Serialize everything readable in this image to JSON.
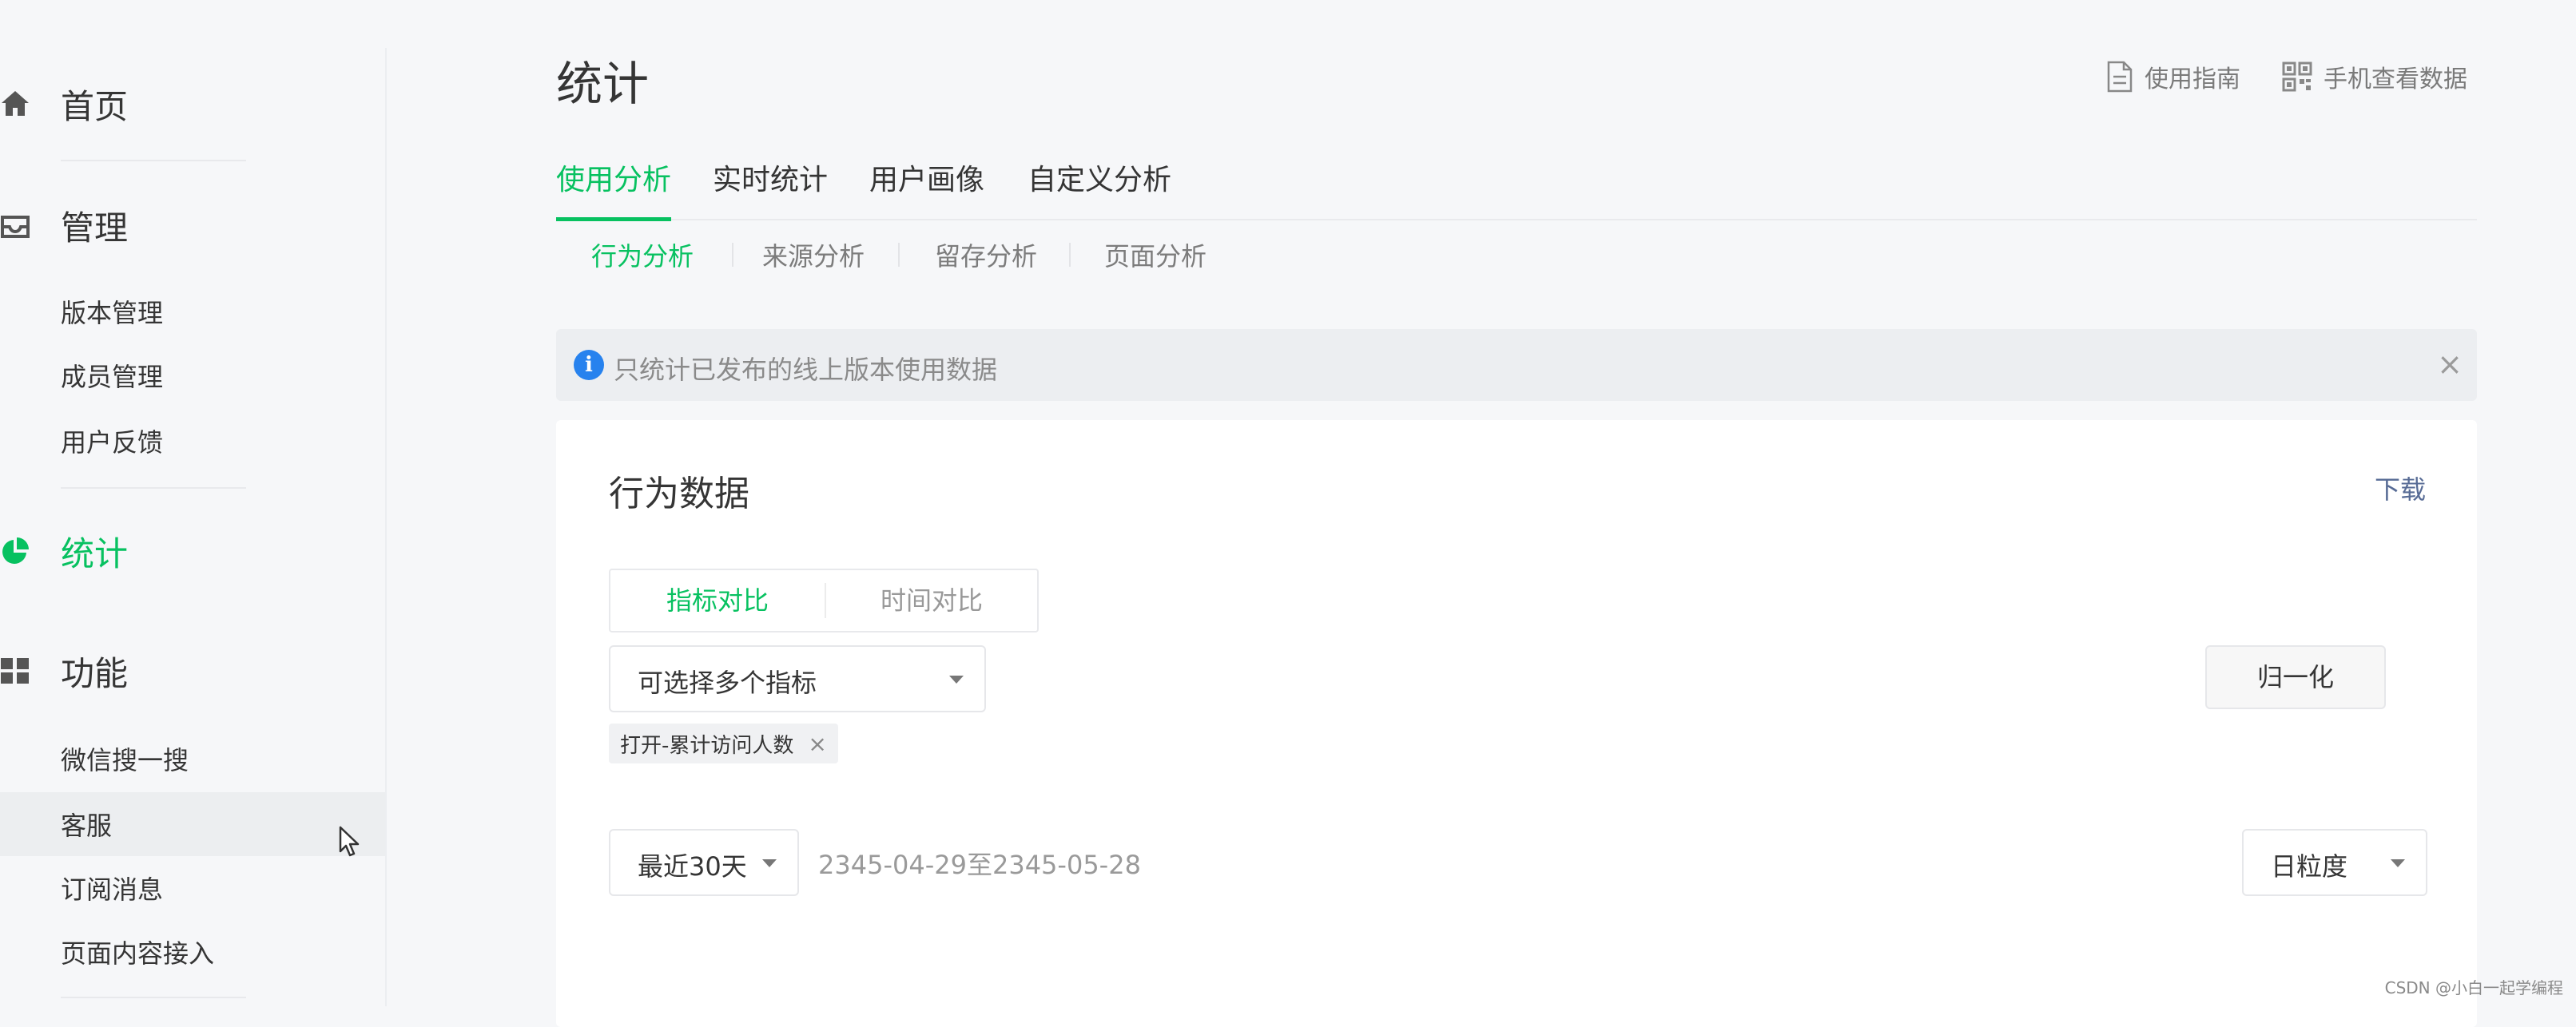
{
  "sidebar": {
    "home": {
      "label": "首页",
      "icon": "home-icon"
    },
    "manage": {
      "label": "管理",
      "icon": "inbox-icon"
    },
    "manage_items": [
      "版本管理",
      "成员管理",
      "用户反馈"
    ],
    "stats": {
      "label": "统计",
      "icon": "pie-chart-icon"
    },
    "features": {
      "label": "功能",
      "icon": "grid-icon"
    },
    "feature_items": [
      "微信搜一搜",
      "客服",
      "订阅消息",
      "页面内容接入"
    ]
  },
  "header": {
    "title": "统计",
    "guide": {
      "label": "使用指南",
      "icon": "document-icon"
    },
    "mobile": {
      "label": "手机查看数据",
      "icon": "qrcode-icon"
    }
  },
  "tabs": [
    "使用分析",
    "实时统计",
    "用户画像",
    "自定义分析"
  ],
  "subtabs": [
    "行为分析",
    "来源分析",
    "留存分析",
    "页面分析"
  ],
  "notice": {
    "text": "只统计已发布的线上版本使用数据",
    "close": "×"
  },
  "card": {
    "title": "行为数据",
    "download": "下载",
    "segment": [
      "指标对比",
      "时间对比"
    ],
    "metric_select": {
      "value": "可选择多个指标"
    },
    "normalize": "归一化",
    "tag": {
      "label": "打开-累计访问人数",
      "close": "×"
    },
    "period_select": {
      "value": "最近30天"
    },
    "date_range": "2345-04-29至2345-05-28",
    "granularity_select": {
      "value": "日粒度"
    }
  },
  "watermark": "CSDN @小白一起学编程",
  "colors": {
    "accent": "#07c160",
    "link": "#576b95",
    "info": "#2782ee"
  }
}
